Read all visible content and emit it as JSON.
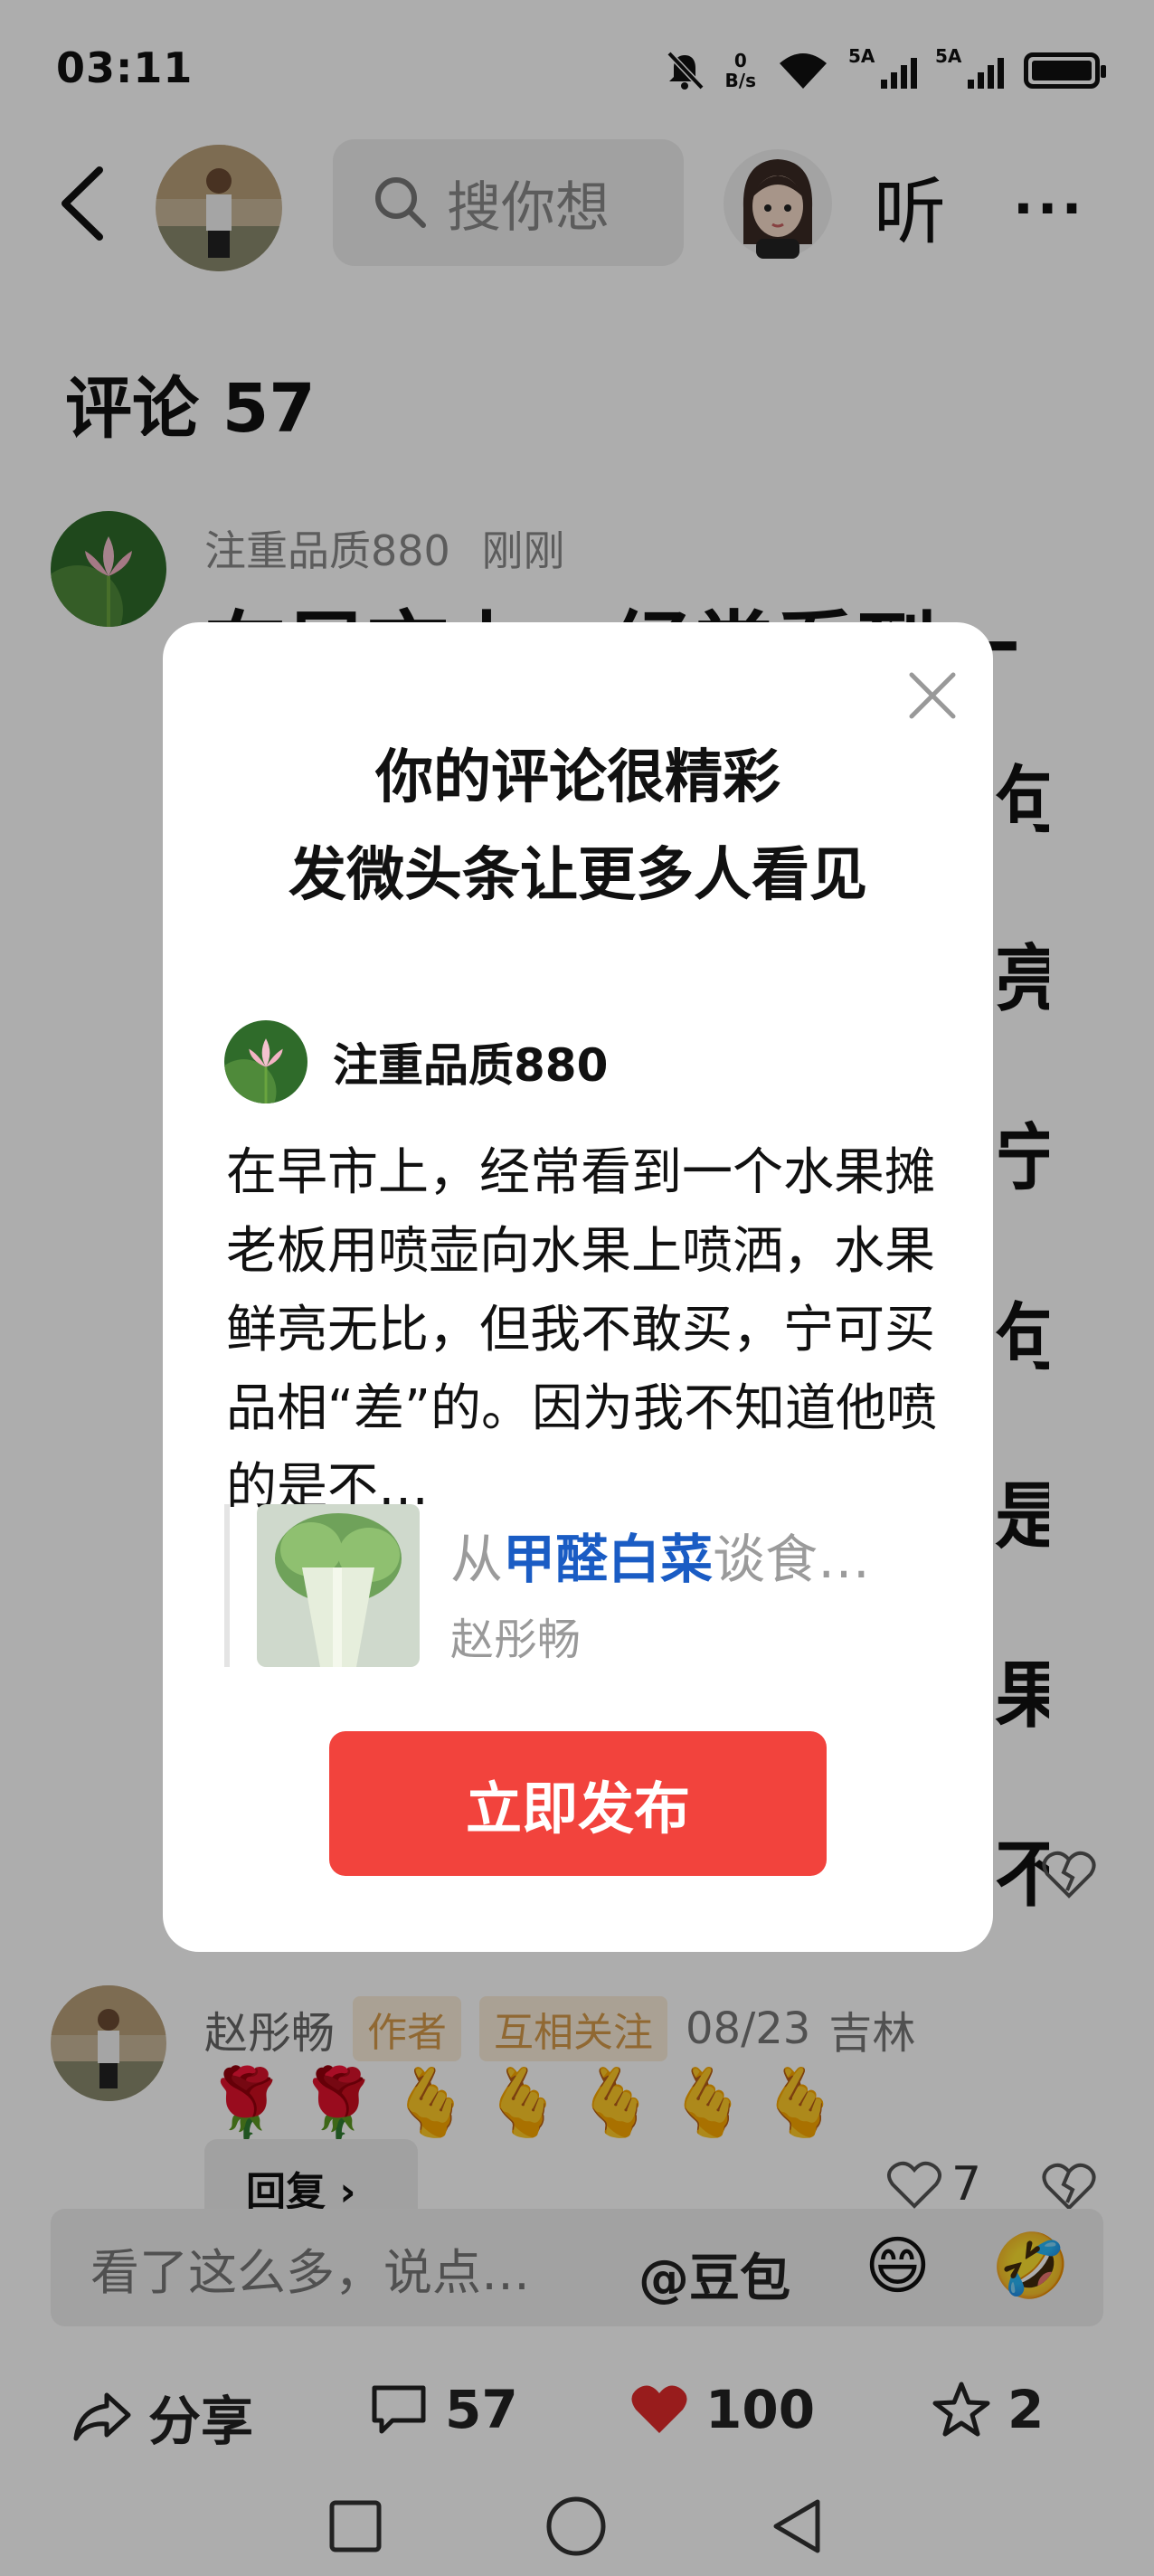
{
  "status_bar": {
    "time": "03:11",
    "net_speed_value": "0",
    "net_speed_unit": "B/s",
    "sim1_label": "5A",
    "sim2_label": "5A",
    "battery_level": 1.0
  },
  "header": {
    "search_placeholder": "搜你想",
    "listen_label": "听",
    "more_label": "···"
  },
  "comments_title": "评论 57",
  "comment1": {
    "user": "注重品质880",
    "time": "刚刚",
    "text_peek": "在早市上，经常看到一",
    "right_edge_chars": [
      "句",
      "亮",
      "宁",
      "句",
      "是",
      "果",
      "不"
    ]
  },
  "comment2": {
    "user": "赵彤畅",
    "tag_author": "作者",
    "tag_mutual": "互相关注",
    "time": "08/23",
    "location": "吉林",
    "emojis": [
      "🌹",
      "🌹",
      "🫰",
      "🫰",
      "🫰",
      "🫰",
      "🫰"
    ],
    "reply_label": "回复",
    "like_count": "7"
  },
  "input_bar": {
    "placeholder": "看了这么多，说点…",
    "at_label": "@豆包",
    "emoji1": "😄",
    "emoji2": "🤣"
  },
  "action_bar": {
    "share_label": "分享",
    "comment_count": "57",
    "like_count": "100",
    "favorite_count": "2"
  },
  "modal": {
    "title_line1": "你的评论很精彩",
    "title_line2": "发微头条让更多人看见",
    "user": "注重品质880",
    "text": "在早市上，经常看到一个水果摊老板用喷壶向水果上喷洒，水果鲜亮无比，但我不敢买，宁可买品相“差”的。因为我不知道他喷的是不…",
    "article_title_prefix": "从",
    "article_title_highlight": "甲醛白菜",
    "article_title_suffix": "谈食…",
    "article_author": "赵彤畅",
    "publish_label": "立即发布"
  },
  "colors": {
    "accent_red": "#f2433d",
    "link_blue": "#1a5cc4",
    "tag_text": "#d49a4a",
    "heart_red": "#e02a2a"
  }
}
